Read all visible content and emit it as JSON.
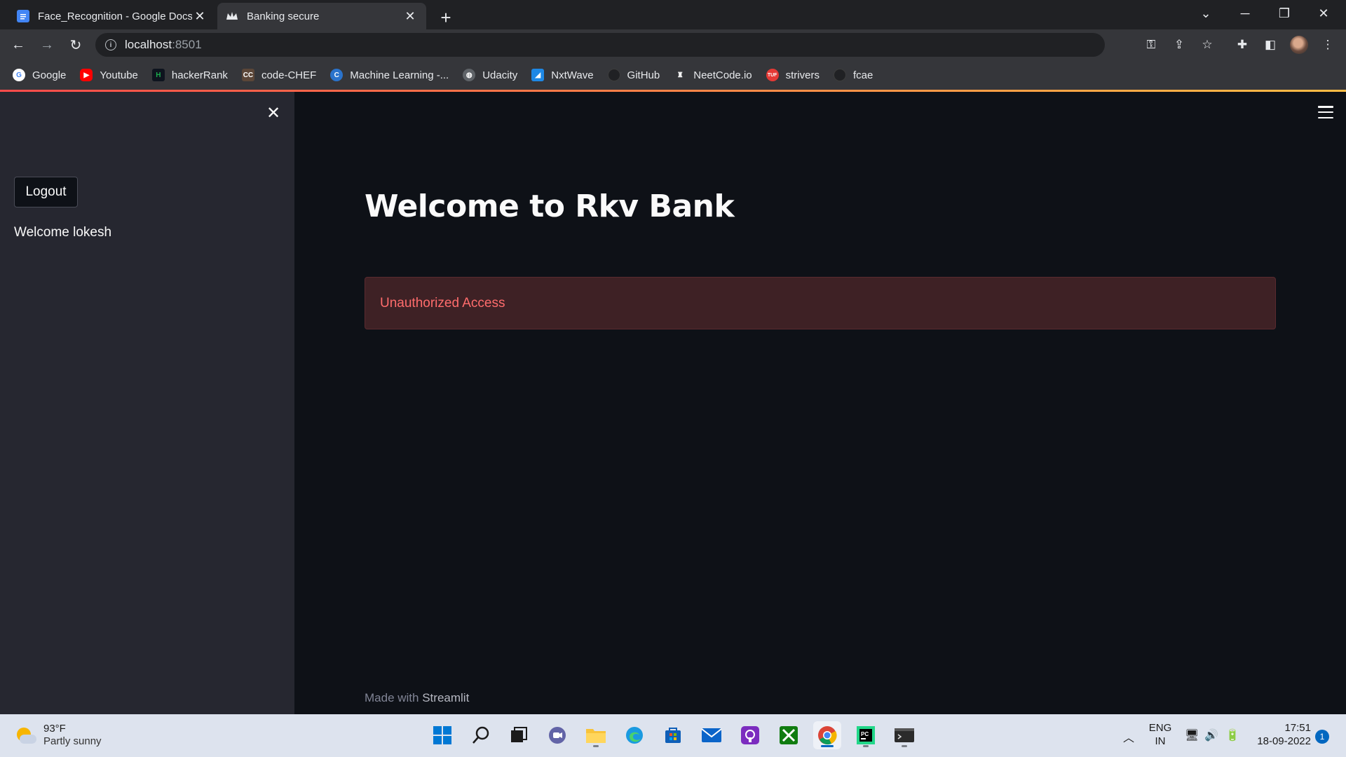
{
  "browser": {
    "tabs": [
      {
        "title": "Face_Recognition - Google Docs",
        "icon": "google-docs-icon",
        "active": false
      },
      {
        "title": "Banking secure",
        "icon": "streamlit-crown-icon",
        "active": true
      }
    ],
    "address": {
      "host": "localhost",
      "port": ":8501"
    },
    "bookmarks": [
      {
        "label": "Google",
        "icon": "google-icon",
        "color": "#ffffff"
      },
      {
        "label": "Youtube",
        "icon": "youtube-icon",
        "color": "#ff0000"
      },
      {
        "label": "hackerRank",
        "icon": "hackerrank-icon",
        "color": "#1ba94c"
      },
      {
        "label": "code-CHEF",
        "icon": "codechef-icon",
        "color": "#5b4638"
      },
      {
        "label": "Machine Learning -...",
        "icon": "coursera-icon",
        "color": "#2a73cc"
      },
      {
        "label": "Udacity",
        "icon": "globe-icon",
        "color": "#5f6368"
      },
      {
        "label": "NxtWave",
        "icon": "nxtwave-icon",
        "color": "#1e88e5"
      },
      {
        "label": "GitHub",
        "icon": "github-icon",
        "color": "#202124"
      },
      {
        "label": "NeetCode.io",
        "icon": "neetcode-icon",
        "color": "#ffffff"
      },
      {
        "label": "strivers",
        "icon": "striver-icon",
        "color": "#e53935"
      },
      {
        "label": "fcae",
        "icon": "globe-icon",
        "color": "#202124"
      }
    ]
  },
  "sidebar": {
    "logout_label": "Logout",
    "welcome_text": "Welcome lokesh"
  },
  "main": {
    "title": "Welcome to Rkv Bank",
    "alert_text": "Unauthorized Access",
    "footer_prefix": "Made with",
    "footer_brand": "Streamlit"
  },
  "taskbar": {
    "weather_temp": "93°F",
    "weather_condition": "Partly sunny",
    "lang_top": "ENG",
    "lang_bottom": "IN",
    "time": "17:51",
    "date": "18-09-2022",
    "notification_count": "1"
  },
  "colors": {
    "app_bg": "#0e1117",
    "sidebar_bg": "#262730",
    "error_text": "#ff6c6c",
    "error_bg": "#3e2125",
    "accent": "#ff4b4b"
  }
}
